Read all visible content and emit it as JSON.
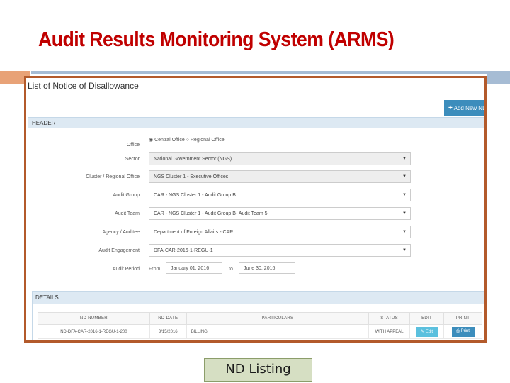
{
  "slide": {
    "title": "Audit Results Monitoring System (ARMS)",
    "caption": "ND Listing"
  },
  "screen": {
    "title": "List of Notice of Disallowance",
    "add_button": "Add New ND",
    "header_label": "HEADER",
    "form": {
      "office": {
        "label": "Office",
        "option_central": "Central Office",
        "option_regional": "Regional Office",
        "selected": "Central Office"
      },
      "sector": {
        "label": "Sector",
        "value": "National Government Sector (NGS)"
      },
      "cluster": {
        "label": "Cluster / Regional Office",
        "value": "NGS Cluster 1 - Executive Offices"
      },
      "audit_group": {
        "label": "Audit Group",
        "value": "CAR - NGS Cluster 1 - Audit Group B"
      },
      "audit_team": {
        "label": "Audit Team",
        "value": "CAR - NGS Cluster 1 - Audit Group B- Audit Team 5"
      },
      "agency": {
        "label": "Agency / Auditee",
        "value": "Department of Foreign Affairs - CAR"
      },
      "engagement": {
        "label": "Audit Engagement",
        "value": "DFA-CAR-2016-1-REGU-1"
      },
      "period": {
        "label": "Audit Period",
        "from_label": "From:",
        "from_value": "January 01, 2016",
        "to_label": "to",
        "to_value": "June 30, 2016"
      }
    },
    "details": {
      "label": "DETAILS",
      "columns": [
        "ND NUMBER",
        "ND DATE",
        "PARTICULARS",
        "STATUS",
        "EDIT",
        "PRINT"
      ],
      "rows": [
        {
          "nd_number": "ND-DFA-CAR-2016-1-REGU-1-200",
          "nd_date": "3/15/2016",
          "particulars": "BILLING",
          "status": "WITH APPEAL",
          "edit": "Edit",
          "print": "Print"
        }
      ]
    }
  },
  "colors": {
    "title_red": "#c00000",
    "frame_border": "#b35a2b",
    "primary_blue": "#3c8dbc",
    "info_blue": "#5bc0de"
  }
}
